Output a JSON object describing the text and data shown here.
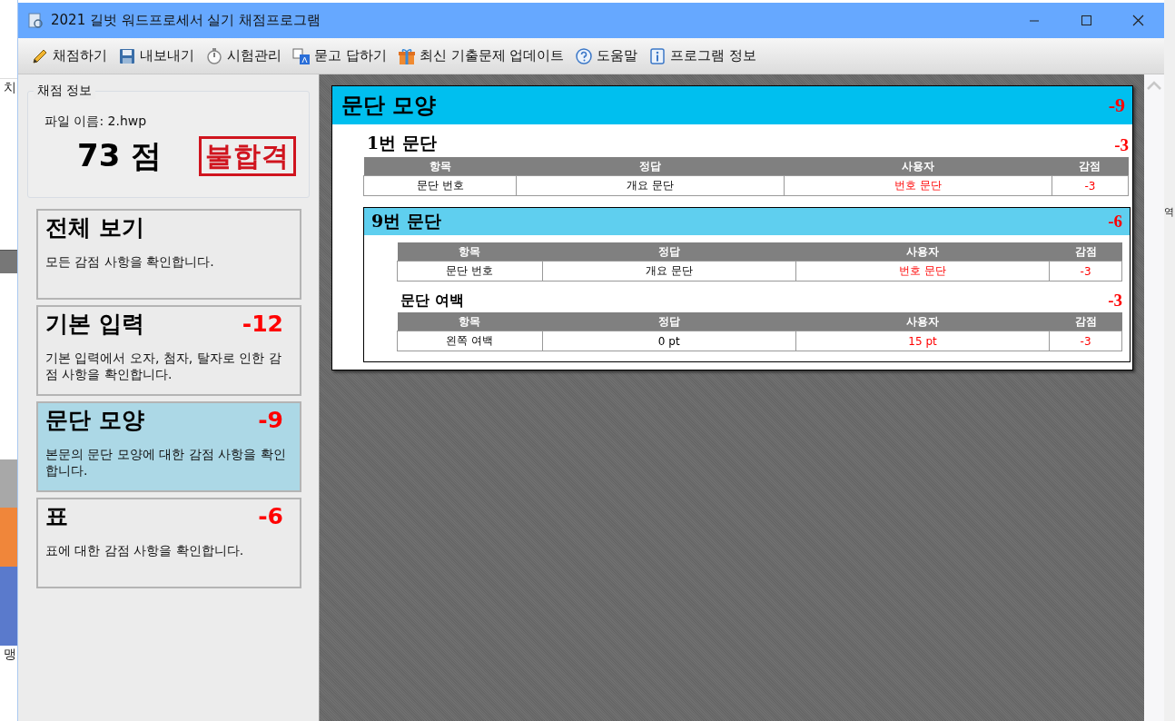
{
  "background_window": {
    "left_texts": [
      "치",
      "맹"
    ],
    "right_texts": [
      "역"
    ]
  },
  "window": {
    "title": "2021 길벗 워드프로세서 실기 채점프로그램"
  },
  "toolbar": [
    {
      "label": "채점하기",
      "kind": "pencil"
    },
    {
      "label": "내보내기",
      "kind": "floppy"
    },
    {
      "label": "시험관리",
      "kind": "stopwatch"
    },
    {
      "label": "묻고 답하기",
      "kind": "translate"
    },
    {
      "label": "최신 기출문제 업데이트",
      "kind": "gift"
    },
    {
      "label": "도움말",
      "kind": "help"
    },
    {
      "label": "프로그램 정보",
      "kind": "info"
    }
  ],
  "score_info": {
    "legend": "채점 정보",
    "file_name": "파일 이름: 2.hwp",
    "score": "73 점",
    "stamp": "불합격"
  },
  "categories": [
    {
      "title": "전체 보기",
      "description": "모든 감점 사항을 확인합니다.",
      "selected": false
    },
    {
      "title": "기본 입력",
      "deduction": "-12",
      "description": "기본 입력에서 오자, 첨자, 탈자로 인한 감점 사항을 확인합니다.",
      "selected": false
    },
    {
      "title": "문단 모양",
      "deduction": "-9",
      "description": "본문의 문단 모양에 대한 감점 사항을 확인합니다.",
      "selected": true
    },
    {
      "title": "표",
      "deduction": "-6",
      "description": "표에 대한 감점 사항을 확인합니다.",
      "selected": false
    }
  ],
  "report": {
    "title": "문단 모양",
    "deduction": "-9",
    "sections": [
      {
        "kind": "plain",
        "title": "1번 문단",
        "deduction": "-3",
        "items": [
          {
            "table": {
              "columns": [
                "항목",
                "정답",
                "사용자",
                "감점"
              ],
              "rows": [
                {
                  "cells": [
                    "문단 번호",
                    "개요 문단",
                    "번호 문단",
                    "-3"
                  ],
                  "wrong": true
                }
              ]
            }
          }
        ]
      },
      {
        "kind": "boxed",
        "title": "9번 문단",
        "deduction": "-6",
        "items": [
          {
            "table": {
              "columns": [
                "항목",
                "정답",
                "사용자",
                "감점"
              ],
              "rows": [
                {
                  "cells": [
                    "문단 번호",
                    "개요 문단",
                    "번호 문단",
                    "-3"
                  ],
                  "wrong": true
                }
              ]
            }
          },
          {
            "title": "문단 여백",
            "deduction": "-3",
            "table": {
              "columns": [
                "항목",
                "정답",
                "사용자",
                "감점"
              ],
              "rows": [
                {
                  "cells": [
                    "왼쪽 여백",
                    "0 pt",
                    "15 pt",
                    "-3"
                  ],
                  "wrong": true
                }
              ]
            }
          }
        ]
      }
    ]
  }
}
